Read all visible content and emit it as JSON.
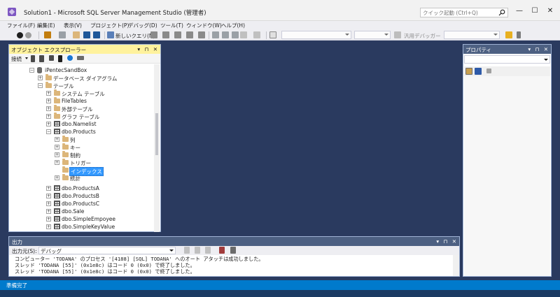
{
  "window": {
    "title": "Solution1 - Microsoft SQL Server Management Studio (管理者)",
    "quick_launch_placeholder": "クイック起動 (Ctrl+Q)",
    "minimize": "—",
    "maximize": "☐",
    "close": "✕"
  },
  "menu": [
    "ファイル(F)",
    "編集(E)",
    "表示(V)",
    "プロジェクト(P)",
    "デバッグ(D)",
    "ツール(T)",
    "ウィンドウ(W)",
    "ヘルプ(H)"
  ],
  "toolbar": {
    "new_query": "新しいクエリ(N)",
    "debugger": "汎用デバッガー"
  },
  "object_explorer": {
    "title": "オブジェクト エクスプローラー",
    "connect_label": "接続",
    "pane_icons": "▾ ⊓ ✕",
    "tree": [
      {
        "label": "iPentecSandBox",
        "type": "database",
        "expander": "−"
      },
      {
        "label": "データベース ダイアグラム",
        "type": "folder",
        "expander": "+"
      },
      {
        "label": "テーブル",
        "type": "folder",
        "expander": "−"
      },
      {
        "label": "システム テーブル",
        "type": "folder",
        "expander": "+"
      },
      {
        "label": "FileTables",
        "type": "folder",
        "expander": "+"
      },
      {
        "label": "外部テーブル",
        "type": "folder",
        "expander": "+"
      },
      {
        "label": "グラフ テーブル",
        "type": "folder",
        "expander": "+"
      },
      {
        "label": "dbo.Namelist",
        "type": "table",
        "expander": "+"
      },
      {
        "label": "dbo.Products",
        "type": "table",
        "expander": "−"
      },
      {
        "label": "列",
        "type": "folder",
        "expander": "+"
      },
      {
        "label": "キー",
        "type": "folder",
        "expander": "+"
      },
      {
        "label": "制約",
        "type": "folder",
        "expander": "+"
      },
      {
        "label": "トリガー",
        "type": "folder",
        "expander": "+"
      },
      {
        "label": "インデックス",
        "type": "folder",
        "expander": "",
        "selected": true
      },
      {
        "label": "統計",
        "type": "folder",
        "expander": "+"
      },
      {
        "label": "dbo.ProductsA",
        "type": "table",
        "expander": "+"
      },
      {
        "label": "dbo.ProductsB",
        "type": "table",
        "expander": "+"
      },
      {
        "label": "dbo.ProductsC",
        "type": "table",
        "expander": "+"
      },
      {
        "label": "dbo.Sale",
        "type": "table",
        "expander": "+"
      },
      {
        "label": "dbo.SimpleEmpoyee",
        "type": "table",
        "expander": "+"
      },
      {
        "label": "dbo.SimpleKeyValue",
        "type": "table",
        "expander": "+"
      }
    ]
  },
  "properties": {
    "title": "プロパティ",
    "pane_icons": "▾ ⊓ ✕"
  },
  "output": {
    "title": "出力",
    "pane_icons": "▾ ⊓ ✕",
    "source_label": "出力元(S):",
    "source_value": "デバッグ",
    "lines": [
      "コンピューター 'TODANA' のプロセス '[4188] [SQL] TODANA' へのオート アタッチは成功しました。",
      "スレッド 'TODANA [55]' (0x1e8c) はコード 0 (0x0) で終了しました。",
      "スレッド 'TODANA [55]' (0x1e8c) はコード 0 (0x0) で終了しました。"
    ]
  },
  "status": {
    "text": "準備完了"
  },
  "colors": {
    "accent": "#007acc",
    "active_pane_header": "#fff29d",
    "inactive_pane_header": "#4d6082",
    "background": "#2a3a5f",
    "selection": "#3399ff"
  }
}
